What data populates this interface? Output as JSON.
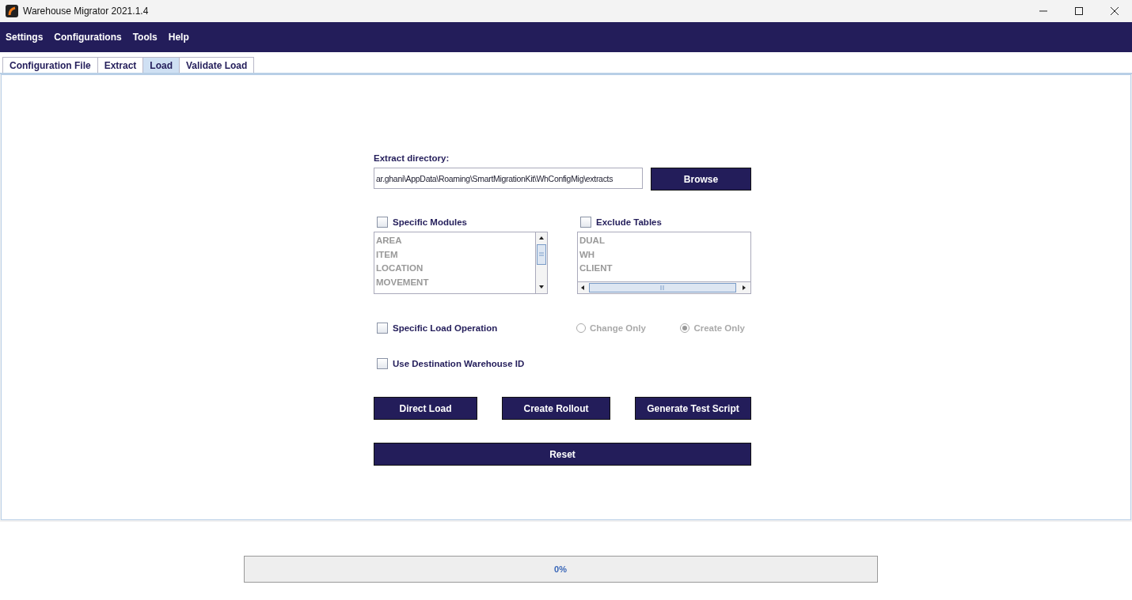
{
  "window": {
    "title": "Warehouse Migrator 2021.1.4"
  },
  "menu": [
    "Settings",
    "Configurations",
    "Tools",
    "Help"
  ],
  "tabs": [
    {
      "label": "Configuration File",
      "selected": false
    },
    {
      "label": "Extract",
      "selected": false
    },
    {
      "label": "Load",
      "selected": true
    },
    {
      "label": "Validate Load",
      "selected": false
    }
  ],
  "extract_directory": {
    "label": "Extract directory:",
    "value": "ar.ghani\\AppData\\Roaming\\SmartMigrationKit\\WhConfigMig\\extracts",
    "button": "Browse"
  },
  "specific_modules": {
    "label": "Specific Modules",
    "checked": false,
    "items": [
      "AREA",
      "ITEM",
      "LOCATION",
      "MOVEMENT"
    ]
  },
  "exclude_tables": {
    "label": "Exclude Tables",
    "checked": false,
    "items": [
      "DUAL",
      "WH",
      "CLIENT"
    ]
  },
  "specific_load_operation": {
    "label": "Specific Load Operation",
    "checked": false,
    "options": [
      {
        "label": "Change Only",
        "selected": false,
        "disabled": true
      },
      {
        "label": "Create Only",
        "selected": true,
        "disabled": true
      }
    ]
  },
  "use_destination_warehouse_id": {
    "label": "Use Destination Warehouse ID",
    "checked": false
  },
  "actions": [
    "Direct Load",
    "Create Rollout",
    "Generate Test Script"
  ],
  "reset": "Reset",
  "progress": {
    "level": 0,
    "text": "0%"
  }
}
